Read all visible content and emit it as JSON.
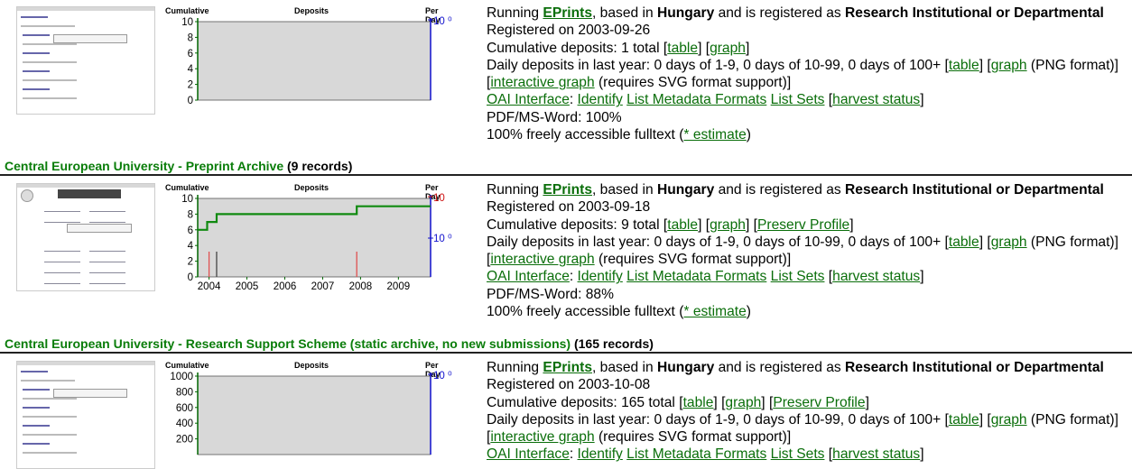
{
  "repos": [
    {
      "title": "",
      "count": "",
      "thumb_kind": "plain",
      "chart": {
        "label_cumulative": "Cumulative",
        "label_deposits": "Deposits",
        "label_perday": "Per Day",
        "y_ticks": [
          "10",
          "8",
          "6",
          "4",
          "2",
          "0"
        ],
        "x_ticks": [],
        "right_top": "10 ⁰",
        "right_mid": "",
        "cumulative_steps": [],
        "daily_spikes": []
      },
      "info": {
        "software": "EPrints",
        "country": "Hungary",
        "type": "Research Institutional or Departmental",
        "registered": "Registered on 2003-09-26",
        "cumulative": "Cumulative deposits: 1 total ",
        "has_preserv": false,
        "daily": "Daily deposits in last year: 0 days of 1-9, 0 days of 10-99, 0 days of 100+ ",
        "pdf": "PDF/MS-Word: 100%",
        "fulltext": "100% freely accessible fulltext ("
      }
    },
    {
      "title": "Central European University - Preprint Archive",
      "count": "(9 records)",
      "thumb_kind": "academic",
      "chart": {
        "label_cumulative": "Cumulative",
        "label_deposits": "Deposits",
        "label_perday": "Per Day",
        "y_ticks": [
          "10",
          "8",
          "6",
          "4",
          "2",
          "0"
        ],
        "x_ticks": [
          "2004",
          "2005",
          "2006",
          "2007",
          "2008",
          "2009"
        ],
        "right_top": "10",
        "right_mid": "10 ⁰",
        "cumulative_steps": [
          [
            2003.7,
            6
          ],
          [
            2003.95,
            7
          ],
          [
            2004.2,
            8
          ],
          [
            2007.9,
            9
          ],
          [
            2009.85,
            9
          ]
        ],
        "daily_spikes": [
          [
            2004.0,
            "#e05050"
          ],
          [
            2004.2,
            "#444444"
          ],
          [
            2007.9,
            "#e05050"
          ]
        ]
      },
      "info": {
        "software": "EPrints",
        "country": "Hungary",
        "type": "Research Institutional or Departmental",
        "registered": "Registered on 2003-09-18",
        "cumulative": "Cumulative deposits: 9 total ",
        "has_preserv": true,
        "daily": "Daily deposits in last year: 0 days of 1-9, 0 days of 10-99, 0 days of 100+ ",
        "pdf": "PDF/MS-Word: 88%",
        "fulltext": "100% freely accessible fulltext ("
      }
    },
    {
      "title": "Central European University - Research Support Scheme (static archive, no new submissions)",
      "count": "(165 records)",
      "thumb_kind": "plain",
      "chart": {
        "label_cumulative": "Cumulative",
        "label_deposits": "Deposits",
        "label_perday": "Per Day",
        "y_ticks": [
          "1000",
          "800",
          "600",
          "400",
          "200"
        ],
        "x_ticks": [],
        "right_top": "10 ⁰",
        "right_mid": "",
        "cumulative_steps": [],
        "daily_spikes": []
      },
      "info": {
        "software": "EPrints",
        "country": "Hungary",
        "type": "Research Institutional or Departmental",
        "registered": "Registered on 2003-10-08",
        "cumulative": "Cumulative deposits: 165 total ",
        "has_preserv": true,
        "daily": "Daily deposits in last year: 0 days of 1-9, 0 days of 10-99, 0 days of 100+ ",
        "pdf": "",
        "fulltext": ""
      }
    }
  ],
  "common": {
    "running": "Running ",
    "based_in": ", based in ",
    "registered_as": " and is registered as ",
    "table": "table",
    "graph": "graph",
    "png_format": " (PNG format)]",
    "interactive_graph": "interactive graph",
    "svg_note": " (requires SVG format support)]",
    "oai": "OAI Interface",
    "identify": "Identify",
    "list_formats": "List Metadata Formats",
    "list_sets": "List Sets",
    "harvest_status": "harvest status",
    "preserv_profile": "Preserv Profile",
    "estimate": "* estimate",
    "colors": {
      "link": "#0a6e0a",
      "title": "#0a7d0a",
      "cumulative_line": "#108a10",
      "plot_bg": "#d8d8d8",
      "right_axis": "#1010cc"
    }
  }
}
